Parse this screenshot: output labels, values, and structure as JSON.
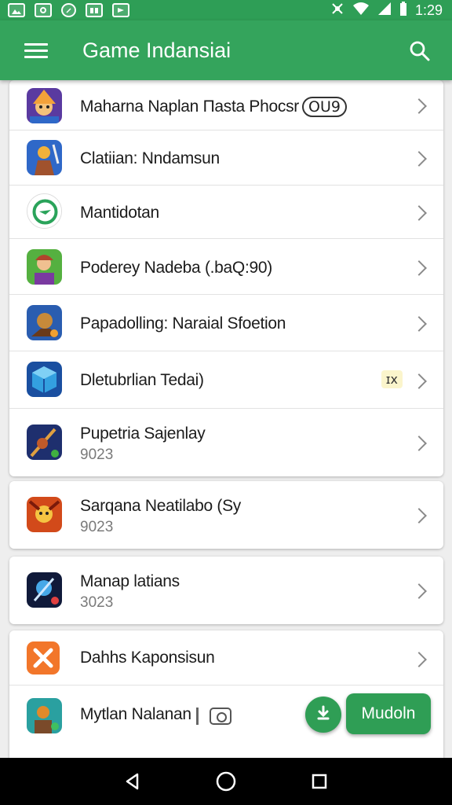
{
  "status_bar": {
    "time": "1:29",
    "left_icons": [
      "image-icon",
      "photo-icon",
      "whatsapp-icon",
      "gallery-icon",
      "notification-icon"
    ],
    "right_icons": [
      "mute-icon",
      "wifi-icon",
      "signal-icon",
      "battery-icon"
    ]
  },
  "app_bar": {
    "title": "Game Indansiai",
    "color": "#34a45c"
  },
  "list": {
    "items": [
      {
        "title": "Maharna Naplan Пasta Phocsr",
        "tag": "OU9",
        "sub": "",
        "icon": "wizard-game-icon",
        "colors": [
          "#f3a23a",
          "#5a3aa0"
        ]
      },
      {
        "title": "Clatiian: Nndamsun",
        "sub": "",
        "icon": "warrior-game-icon",
        "colors": [
          "#2f68c8",
          "#f2b13a"
        ]
      },
      {
        "title": "Mantidotan",
        "sub": "",
        "icon": "compass-icon",
        "colors": [
          "#ffffff",
          "#2aa35a"
        ]
      },
      {
        "title": "Poderey Nadeba (.baQ:90)",
        "sub": "",
        "icon": "hero-game-icon",
        "colors": [
          "#55b040",
          "#b0442c"
        ]
      },
      {
        "title": "Papadolling: Naraial Sfoetion",
        "sub": "",
        "icon": "knight-game-icon",
        "colors": [
          "#2a5db0",
          "#c78a3a"
        ]
      },
      {
        "title": "Dletubrlian Tedai)",
        "badge": "ɪx",
        "sub": "",
        "icon": "cube-icon",
        "colors": [
          "#33a0e0",
          "#1a4fa0"
        ]
      },
      {
        "title": "Pupetria Sajenlay",
        "sub": "9023",
        "icon": "spear-game-icon",
        "colors": [
          "#1e2f6e",
          "#e0a040"
        ]
      },
      {
        "title": "Sarqana Neatilabo (Sy",
        "sub": "9023",
        "icon": "dragon-game-icon",
        "colors": [
          "#d24a1a",
          "#f5c442"
        ]
      },
      {
        "title": "Manap latians",
        "sub": "3023",
        "icon": "magic-orb-icon",
        "colors": [
          "#101a3a",
          "#46a8e8"
        ]
      },
      {
        "title": "Dahhs Kaponsisun",
        "sub": "",
        "icon": "crossed-tools-icon",
        "colors": [
          "#f2762a",
          "#ffffff"
        ]
      },
      {
        "title": "Mytlan Nalanan",
        "sub": "",
        "icon": "adventure-game-icon",
        "colors": [
          "#2aa0a0",
          "#e08a2a"
        ]
      }
    ]
  },
  "fab": {
    "label": "Mudoln",
    "color": "#2f9e55"
  }
}
